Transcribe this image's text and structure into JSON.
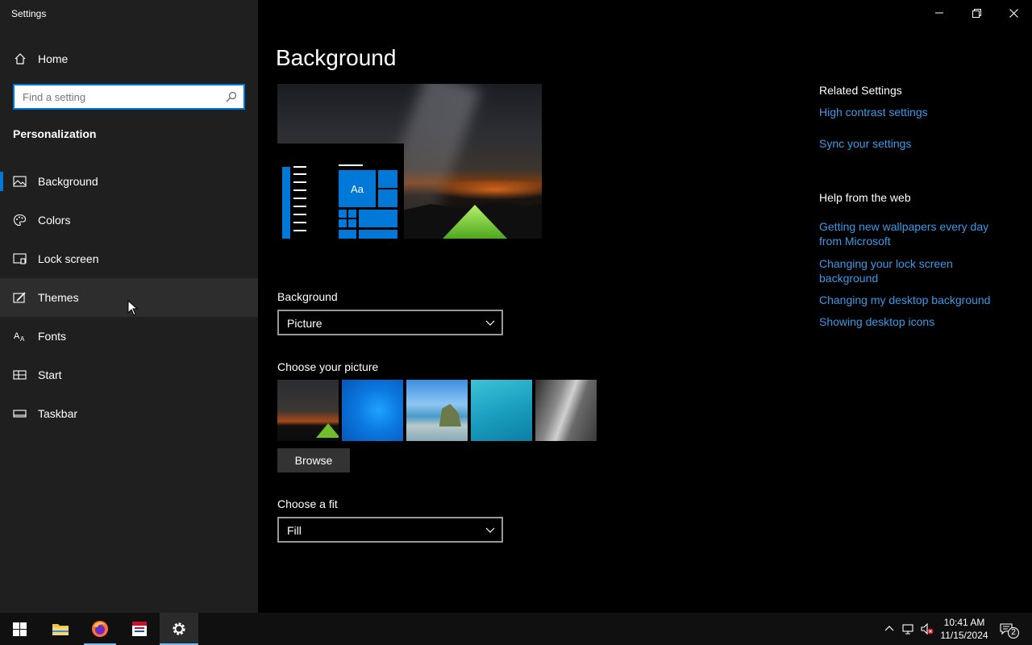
{
  "window": {
    "title": "Settings",
    "controls": {
      "minimize": "minimize-icon",
      "restore": "restore-icon",
      "close": "close-icon"
    }
  },
  "sidebar": {
    "home_label": "Home",
    "search_placeholder": "Find a setting",
    "section": "Personalization",
    "items": [
      {
        "label": "Background",
        "icon": "picture-icon",
        "active": true
      },
      {
        "label": "Colors",
        "icon": "palette-icon"
      },
      {
        "label": "Lock screen",
        "icon": "lock-screen-icon"
      },
      {
        "label": "Themes",
        "icon": "brush-icon",
        "hovered": true
      },
      {
        "label": "Fonts",
        "icon": "font-icon"
      },
      {
        "label": "Start",
        "icon": "start-icon"
      },
      {
        "label": "Taskbar",
        "icon": "taskbar-icon"
      }
    ]
  },
  "main": {
    "title": "Background",
    "preview_tile_text": "Aa",
    "background_label": "Background",
    "background_value": "Picture",
    "choose_picture_label": "Choose your picture",
    "browse_label": "Browse",
    "fit_label": "Choose a fit",
    "fit_value": "Fill"
  },
  "related": {
    "heading": "Related Settings",
    "links": [
      "High contrast settings",
      "Sync your settings"
    ],
    "help_heading": "Help from the web",
    "help_links": [
      "Getting new wallpapers every day from Microsoft",
      "Changing your lock screen background",
      "Changing my desktop background",
      "Showing desktop icons"
    ]
  },
  "taskbar": {
    "time": "10:41 AM",
    "date": "11/15/2024",
    "notification_count": "2"
  },
  "colors": {
    "accent": "#0078d7",
    "link": "#3b9ae8",
    "sidebar_bg": "#1f1f1f"
  }
}
